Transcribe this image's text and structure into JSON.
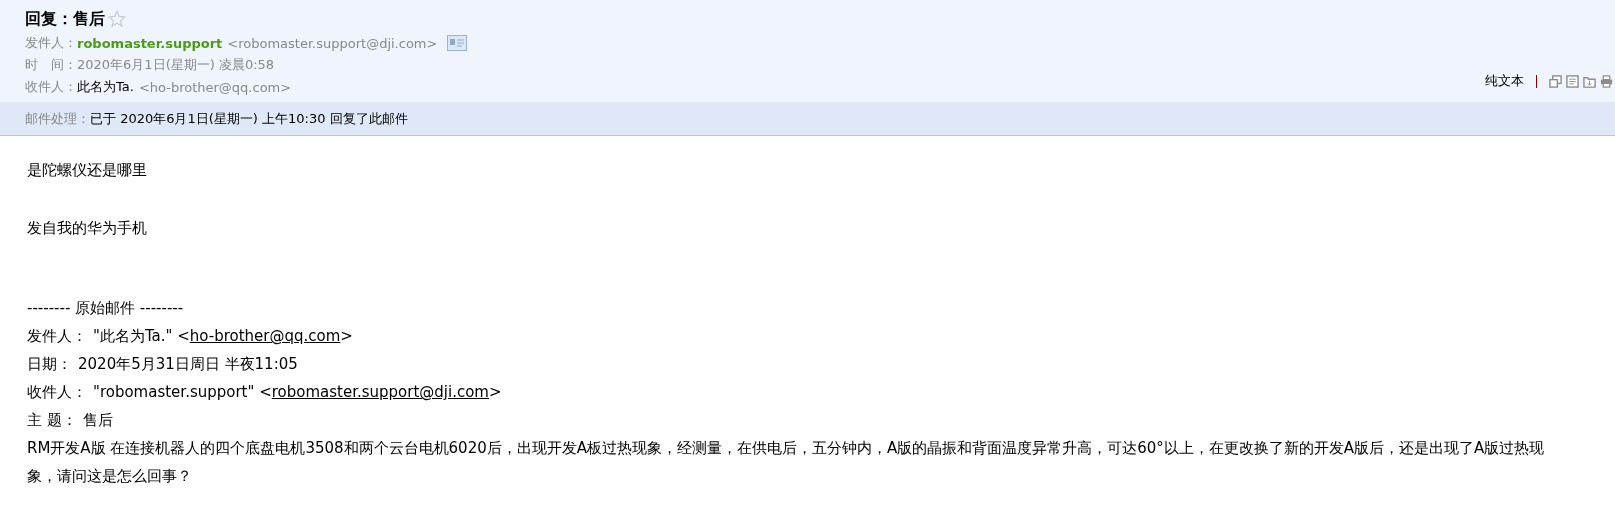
{
  "subject": "回复：售后",
  "meta": [
    {
      "label": "发件人：",
      "name": "robomaster.support",
      "address": "<robomaster.support@dji.com>",
      "kind": "sender"
    },
    {
      "label": "时　间：",
      "value": "2020年6月1日(星期一) 凌晨0:58",
      "kind": "time"
    },
    {
      "label": "收件人：",
      "name": "此名为Ta.",
      "address": "<ho-brother@qq.com>",
      "kind": "recipient"
    }
  ],
  "toolbar": {
    "plain_text": "纯文本"
  },
  "processing": {
    "label": "邮件处理：",
    "value": "已于 2020年6月1日(星期一) 上午10:30 回复了此邮件"
  },
  "body": [
    "是陀螺仪还是哪里",
    "发自我的华为手机"
  ],
  "original": {
    "divider": "-------- 原始邮件 --------",
    "fields": [
      {
        "label": "发件人：",
        "prefix": "\"此名为Ta.\" <",
        "link": "ho-brother@qq.com",
        "suffix": ">"
      },
      {
        "label": "日期：",
        "prefix": "2020年5月31日周日 半夜11:05"
      },
      {
        "label": "收件人：",
        "prefix": "\"robomaster.support\" <",
        "link": "robomaster.support@dji.com",
        "suffix": ">"
      },
      {
        "label": "主 题：",
        "prefix": "售后"
      }
    ],
    "text": "RM开发A版  在连接机器人的四个底盘电机3508和两个云台电机6020后，出现开发A板过热现象，经测量，在供电后，五分钟内，A版的晶振和背面温度异常升高，可达60°以上，在更改换了新的开发A版后，还是出现了A版过热现象，请问这是怎么回事？"
  }
}
